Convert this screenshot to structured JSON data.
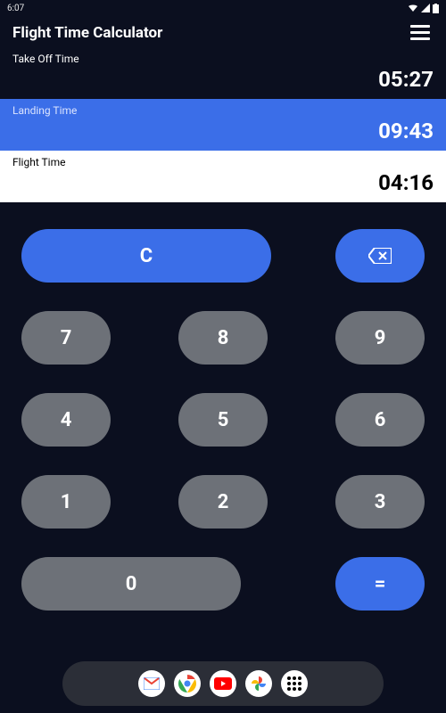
{
  "status_bar": {
    "time": "6:07"
  },
  "header": {
    "title": "Flight Time Calculator"
  },
  "fields": {
    "takeoff": {
      "label": "Take Off Time",
      "value": "05:27"
    },
    "landing": {
      "label": "Landing Time",
      "value": "09:43"
    },
    "flight": {
      "label": "Flight Time",
      "value": "04:16"
    }
  },
  "keys": {
    "clear": "C",
    "k7": "7",
    "k8": "8",
    "k9": "9",
    "k4": "4",
    "k5": "5",
    "k6": "6",
    "k1": "1",
    "k2": "2",
    "k3": "3",
    "k0": "0",
    "equals": "="
  }
}
